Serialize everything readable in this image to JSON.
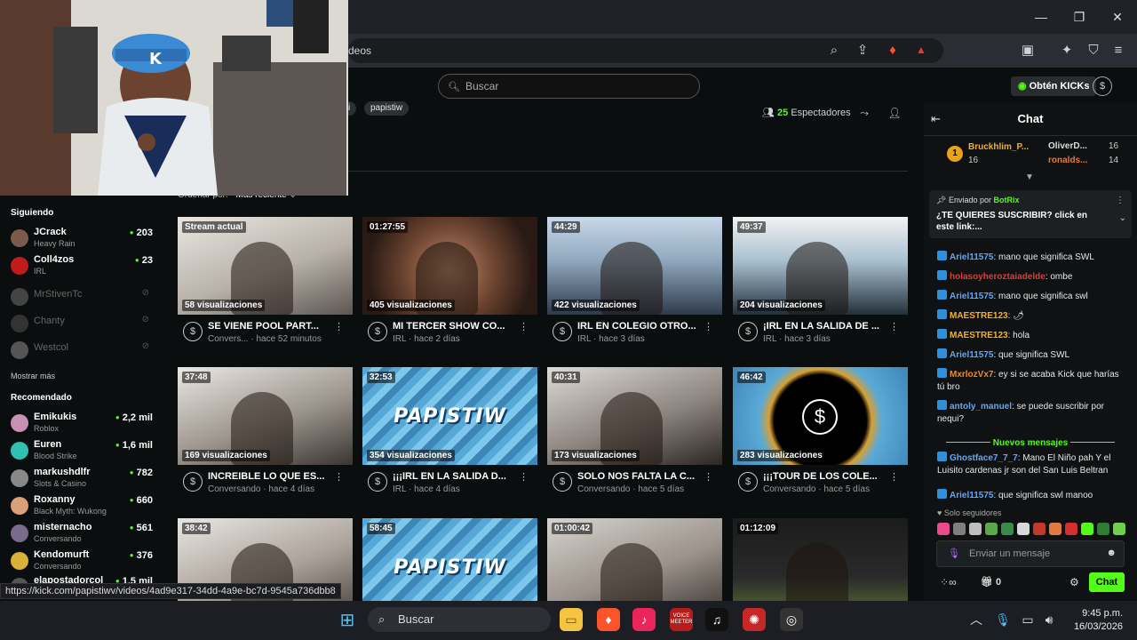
{
  "browser": {
    "url_fragment": "deos",
    "window": {
      "minimize": "—",
      "maximize": "❐",
      "close": "✕"
    }
  },
  "kick": {
    "search_placeholder": "Buscar",
    "tags": [
      "i",
      "papistiw"
    ],
    "viewers_count": "25",
    "viewers_label": "Espectadores",
    "sort_label": "Ordenar por:",
    "sort_value": "Más reciente",
    "get_kicks": "Obtén KICKs"
  },
  "sidebar": {
    "following_title": "Siguiendo",
    "following": [
      {
        "name": "JCrack",
        "sub": "Heavy Rain",
        "count": "203",
        "color": "#7a5b4a"
      },
      {
        "name": "Coll4zos",
        "sub": "IRL",
        "count": "23",
        "color": "#c21b1b"
      }
    ],
    "offline": [
      {
        "name": "MrStivenTc",
        "color": "#444"
      },
      {
        "name": "Chanty",
        "color": "#333"
      },
      {
        "name": "Westcol",
        "color": "#555"
      }
    ],
    "show_more": "Mostrar más",
    "recommended_title": "Recomendado",
    "recommended": [
      {
        "name": "Emikukis",
        "sub": "Roblox",
        "count": "2,2 mil",
        "color": "#c990b5"
      },
      {
        "name": "Euren",
        "sub": "Blood Strike",
        "count": "1,6 mil",
        "color": "#2fc2b2"
      },
      {
        "name": "markushdlfr",
        "sub": "Slots & Casino",
        "count": "782",
        "color": "#888"
      },
      {
        "name": "Roxanny",
        "sub": "Black Myth: Wukong",
        "count": "660",
        "color": "#d9a07a"
      },
      {
        "name": "misternacho",
        "sub": "Conversando",
        "count": "561",
        "color": "#7b6a8c"
      },
      {
        "name": "Kendomurft",
        "sub": "Conversando",
        "count": "376",
        "color": "#d8b13a"
      },
      {
        "name": "elapostadorcol",
        "sub": "",
        "count": "1,5 mil",
        "color": "#555"
      }
    ]
  },
  "videos": [
    {
      "duration": "Stream actual",
      "views": "58 visualizaciones",
      "title": "SE VIENE POOL PART...",
      "meta": "Convers... · hace 52 minutos",
      "style": "room"
    },
    {
      "duration": "01:27:55",
      "views": "405 visualizaciones",
      "title": "MI TERCER SHOW CO...",
      "meta": "IRL · hace 2 días",
      "style": "face"
    },
    {
      "duration": "44:29",
      "views": "422 visualizaciones",
      "title": "IRL EN COLEGIO OTRO...",
      "meta": "IRL · hace 3 días",
      "style": "school"
    },
    {
      "duration": "49:37",
      "views": "204 visualizaciones",
      "title": "¡IRL EN LA SALIDA DE ...",
      "meta": "IRL · hace 3 días",
      "style": "street"
    },
    {
      "duration": "37:48",
      "views": "169 visualizaciones",
      "title": "INCREIBLE LO QUE ES...",
      "meta": "Conversando · hace 4 días",
      "style": "room2"
    },
    {
      "duration": "32:53",
      "views": "354 visualizaciones",
      "title": "¡¡¡IRL EN LA SALIDA D...",
      "meta": "IRL · hace 4 días",
      "style": "papis"
    },
    {
      "duration": "40:31",
      "views": "173 visualizaciones",
      "title": "SOLO NOS FALTA LA C...",
      "meta": "Conversando · hace 5 días",
      "style": "room3"
    },
    {
      "duration": "46:42",
      "views": "283 visualizaciones",
      "title": "¡¡¡TOUR DE LOS COLE...",
      "meta": "Conversando · hace 5 días",
      "style": "logo"
    },
    {
      "duration": "38:42",
      "views": "",
      "title": "",
      "meta": "",
      "style": "room4"
    },
    {
      "duration": "58:45",
      "views": "",
      "title": "",
      "meta": "",
      "style": "papis"
    },
    {
      "duration": "01:00:42",
      "views": "",
      "title": "",
      "meta": "",
      "style": "room5"
    },
    {
      "duration": "01:12:09",
      "views": "",
      "title": "",
      "meta": "",
      "style": "ometv"
    }
  ],
  "papis_text": "PAPISTIW",
  "chat": {
    "title": "Chat",
    "top_supporters": [
      {
        "name": "Bruckhlim_P...",
        "amount": "16",
        "rank": "1"
      },
      {
        "name": "OliverD...",
        "amount": "16"
      },
      {
        "name": "ronalds...",
        "amount": "14"
      }
    ],
    "pinned_by_label": "Enviado por",
    "pinned_by": "BotRix",
    "pinned_msg": "¿TE QUIERES SUSCRIBIR? click en este link:...",
    "messages": [
      {
        "user": "Ariel11575",
        "color": "#5aa9ff",
        "text": ": mano que significa SWL"
      },
      {
        "user": "holasoyheroztaiadelde",
        "color": "#e53935",
        "text": ": ombe"
      },
      {
        "user": "Ariel11575",
        "color": "#5aa9ff",
        "text": ": mano que significa swl"
      },
      {
        "user": "MAESTRE123",
        "color": "#f3b02c",
        "text": ": 🌶"
      },
      {
        "user": "MAESTRE123",
        "color": "#f3b02c",
        "text": ": hola"
      },
      {
        "user": "Ariel11575",
        "color": "#5aa9ff",
        "text": ": que significa SWL"
      },
      {
        "user": "MxrlozVx7",
        "color": "#f08a24",
        "text": ": ey si se acaba Kick que harías tú bro"
      },
      {
        "user": "antoly_manuel",
        "color": "#5aa9ff",
        "text": ": se puede suscribir por nequi?"
      }
    ],
    "new_messages": "Nuevos mensajes",
    "messages_after": [
      {
        "user": "Ghostface7_7_7",
        "color": "#5aa9ff",
        "text": ": Mano El Niño pah Y el Luisito cardenas jr son del San Luis Beltran"
      },
      {
        "user": "Ariel11575",
        "color": "#5aa9ff",
        "text": ": que significa swl manoo"
      }
    ],
    "followers_only": "Solo seguidores",
    "input_placeholder": "Enviar un mensaje",
    "infinity_label": "∞",
    "gift_count": "0",
    "chat_button": "Chat"
  },
  "status_url": "https://kick.com/papistiwv/videos/4ad9e317-34dd-4a9e-bc7d-9545a736dbb8",
  "taskbar": {
    "search": "Buscar",
    "time": "9:45 p.m.",
    "date": "16/03/2026",
    "voicemeeter": "VOICE MEETER"
  }
}
